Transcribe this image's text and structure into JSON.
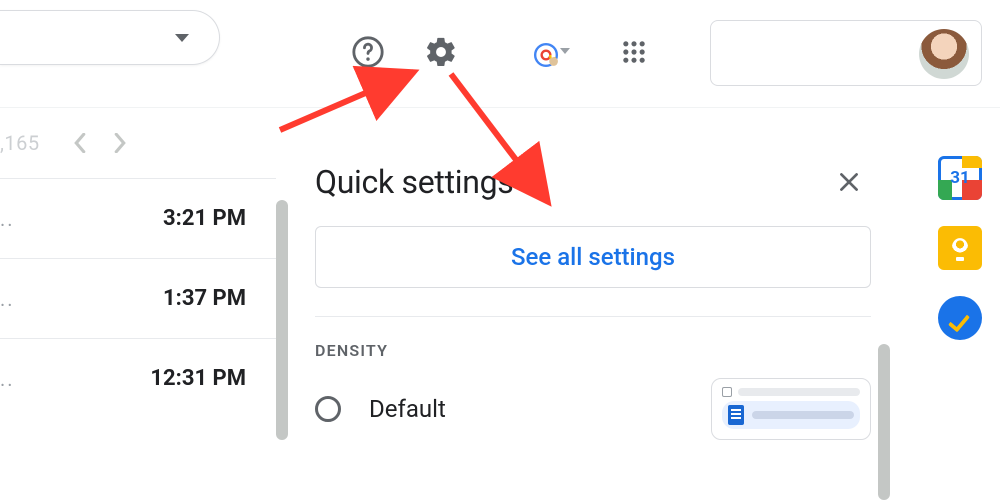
{
  "topbar": {
    "help_icon": "help",
    "settings_icon": "settings",
    "apps_icon": "apps"
  },
  "inbox": {
    "count_fragment": ",165",
    "rows": [
      {
        "time": "3:21 PM"
      },
      {
        "time": "1:37 PM"
      },
      {
        "time": "12:31 PM"
      }
    ]
  },
  "panel": {
    "title": "Quick settings",
    "see_all": "See all settings",
    "density_label": "DENSITY",
    "options": {
      "default": "Default"
    }
  },
  "sidepanel": {
    "calendar_day": "31"
  },
  "annotations": {
    "arrow_to_gear": true,
    "arrow_to_see_all": true
  }
}
